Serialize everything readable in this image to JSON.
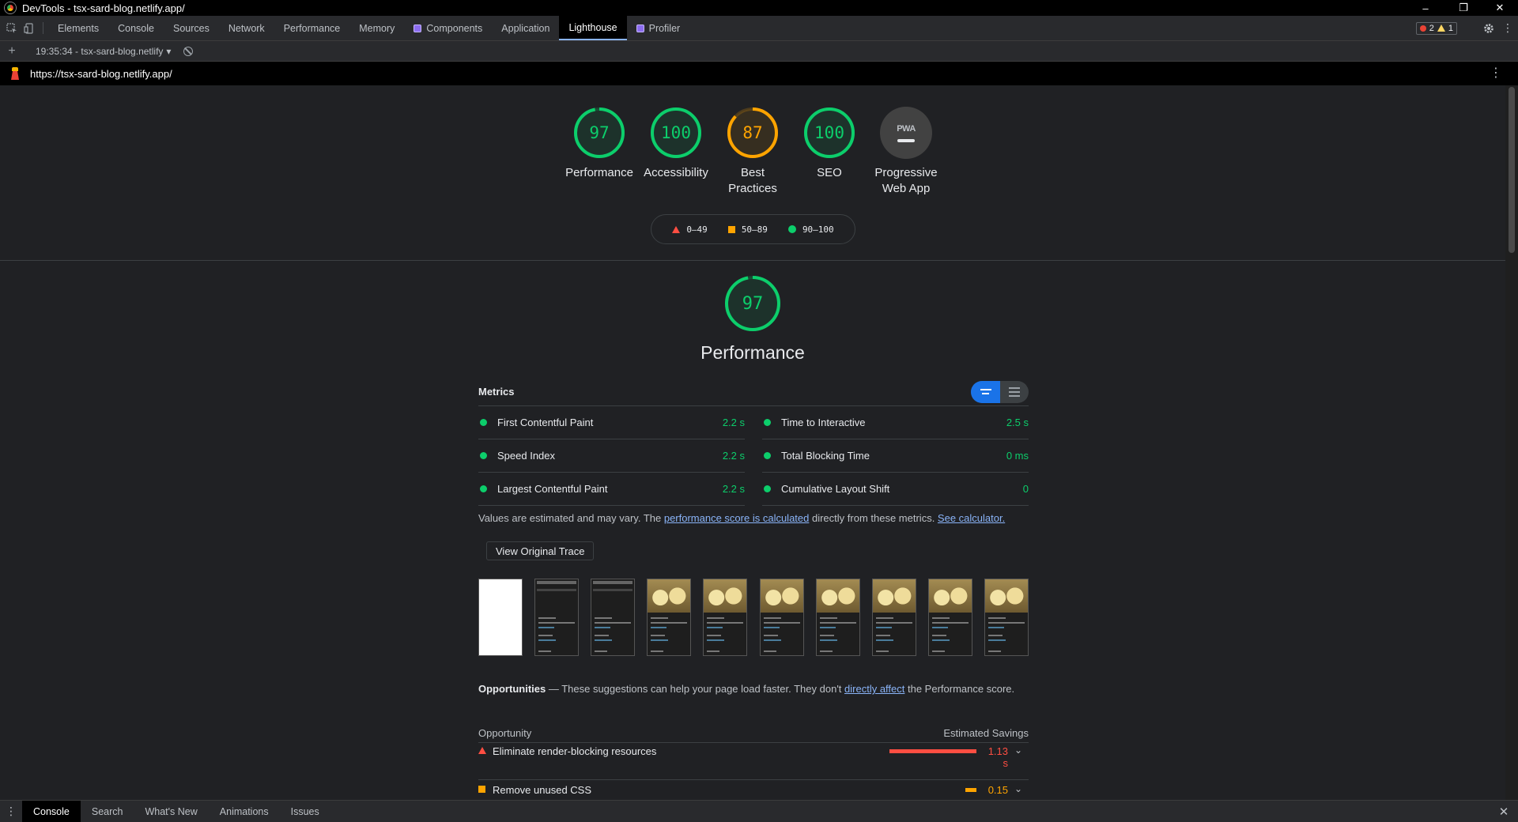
{
  "window": {
    "title": "DevTools - tsx-sard-blog.netlify.app/",
    "minimize": "–",
    "restore": "❐",
    "close": "✕"
  },
  "tabs": [
    {
      "label": "Elements"
    },
    {
      "label": "Console"
    },
    {
      "label": "Sources"
    },
    {
      "label": "Network"
    },
    {
      "label": "Performance"
    },
    {
      "label": "Memory"
    },
    {
      "label": "Components"
    },
    {
      "label": "Application"
    },
    {
      "label": "Lighthouse"
    },
    {
      "label": "Profiler"
    }
  ],
  "active_tab": "Lighthouse",
  "issues": {
    "errors": "2",
    "warnings": "1"
  },
  "toolbar": {
    "add": "+",
    "report": "19:35:34 - tsx-sard-blog.netlify",
    "report_caret": "▾"
  },
  "url": "https://tsx-sard-blog.netlify.app/",
  "gauges": [
    {
      "score": "97",
      "label": "Performance",
      "value": 97,
      "color": "#0cce6b"
    },
    {
      "score": "100",
      "label": "Accessibility",
      "value": 100,
      "color": "#0cce6b"
    },
    {
      "score": "87",
      "label": "Best Practices",
      "value": 87,
      "color": "#ffa400"
    },
    {
      "score": "100",
      "label": "SEO",
      "value": 100,
      "color": "#0cce6b"
    }
  ],
  "pwa": {
    "badge": "PWA",
    "label": "Progressive Web App"
  },
  "legend": {
    "fail": "0–49",
    "average": "50–89",
    "pass": "90–100"
  },
  "performance": {
    "score": "97",
    "value": 97,
    "title": "Performance",
    "metrics_heading": "Metrics",
    "metrics_left": [
      {
        "name": "First Contentful Paint",
        "value": "2.2 s"
      },
      {
        "name": "Speed Index",
        "value": "2.2 s"
      },
      {
        "name": "Largest Contentful Paint",
        "value": "2.2 s"
      }
    ],
    "metrics_right": [
      {
        "name": "Time to Interactive",
        "value": "2.5 s"
      },
      {
        "name": "Total Blocking Time",
        "value": "0 ms"
      },
      {
        "name": "Cumulative Layout Shift",
        "value": "0"
      }
    ],
    "note_pre": "Values are estimated and may vary. The ",
    "note_link1": "performance score is calculated",
    "note_mid": " directly from these metrics. ",
    "note_link2": "See calculator.",
    "trace_button": "View Original Trace"
  },
  "opportunities": {
    "heading": "Opportunities",
    "desc_pre": " — These suggestions can help your page load faster. They don't ",
    "desc_link": "directly affect",
    "desc_post": " the Performance score.",
    "col_left": "Opportunity",
    "col_right": "Estimated Savings",
    "items": [
      {
        "name": "Eliminate render-blocking resources",
        "saving": "1.13 s",
        "fraction": 1.0,
        "color": "#ff4e42"
      },
      {
        "name": "Remove unused CSS",
        "saving": "0.15",
        "fraction": 0.13,
        "color": "#ffa400"
      }
    ]
  },
  "drawer": {
    "tabs": [
      {
        "label": "Console"
      },
      {
        "label": "Search"
      },
      {
        "label": "What's New"
      },
      {
        "label": "Animations"
      },
      {
        "label": "Issues"
      }
    ]
  }
}
